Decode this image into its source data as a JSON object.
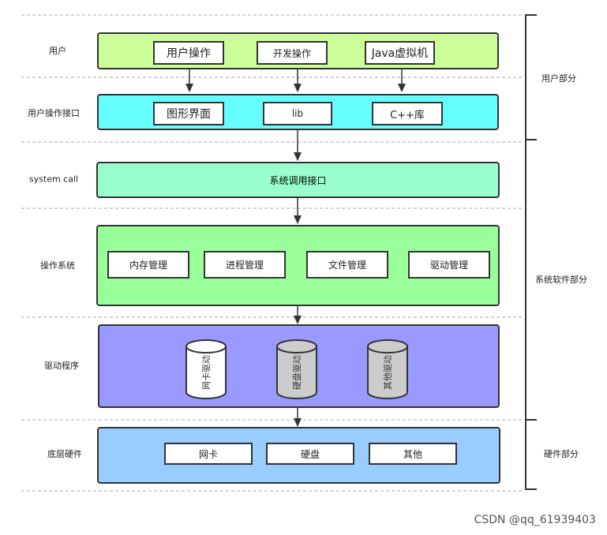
{
  "left_labels": [
    "用户",
    "用户操作接口",
    "system call",
    "操作系统",
    "驱动程序",
    "底层硬件"
  ],
  "right_labels": [
    "用户部分",
    "系统软件部分",
    "硬件部分"
  ],
  "user_layer": {
    "items": [
      "用户操作",
      "开发操作",
      "Java虚拟机"
    ],
    "color": "#ccff99"
  },
  "interface_layer": {
    "items": [
      "图形界面",
      "lib",
      "C++库"
    ],
    "color": "#66ffff"
  },
  "syscall_layer": {
    "label": "系统调用接口",
    "color": "#99ffcc"
  },
  "os_layer": {
    "items": [
      "内存管理",
      "进程管理",
      "文件管理",
      "驱动管理"
    ],
    "color": "#99ff99"
  },
  "driver_layer": {
    "items": [
      "网卡驱动",
      "硬盘驱动",
      "其他驱动"
    ],
    "color": "#9999ff"
  },
  "hardware_layer": {
    "items": [
      "网卡",
      "硬盘",
      "其他"
    ],
    "color": "#99ccff"
  },
  "watermark": "CSDN @qq_61939403"
}
